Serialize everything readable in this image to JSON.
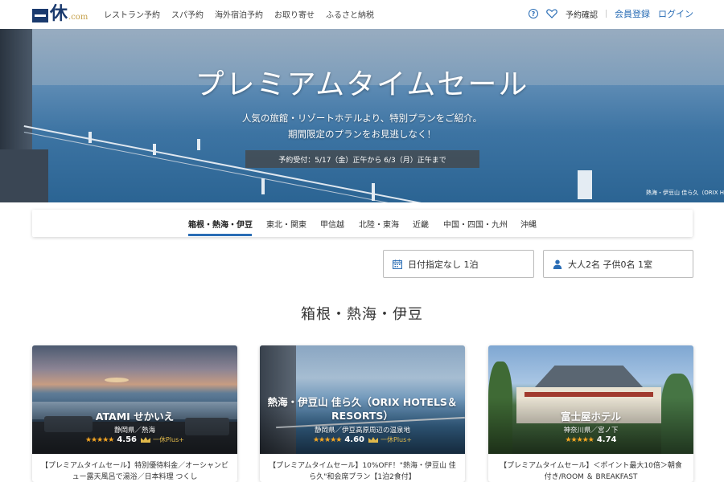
{
  "header": {
    "logo": {
      "kanji": "休",
      "suffix": ".com"
    },
    "nav": [
      "レストラン予約",
      "スパ予約",
      "海外宿泊予約",
      "お取り寄せ",
      "ふるさと納税"
    ],
    "help_icon": "help-circle-icon",
    "favorite_icon": "heart-icon",
    "booking_confirm": "予約確認",
    "register": "会員登録",
    "login": "ログイン"
  },
  "hero": {
    "title": "プレミアムタイムセール",
    "subtitle_line1": "人気の旅館・リゾートホテルより、特別プランをご紹介。",
    "subtitle_line2": "期間限定のプランをお見逃しなく！",
    "period": "予約受付：5/17（金）正午から 6/3（月）正午まで",
    "photo_credit": "熱海・伊豆山 佳ら久（ORIX H"
  },
  "region_tabs": [
    {
      "label": "箱根・熱海・伊豆",
      "active": true
    },
    {
      "label": "東北・関東",
      "active": false
    },
    {
      "label": "甲信越",
      "active": false
    },
    {
      "label": "北陸・東海",
      "active": false
    },
    {
      "label": "近畿",
      "active": false
    },
    {
      "label": "中国・四国・九州",
      "active": false
    },
    {
      "label": "沖縄",
      "active": false
    }
  ],
  "search": {
    "date": {
      "icon": "calendar-icon",
      "value": "日付指定なし 1泊"
    },
    "guests": {
      "icon": "person-icon",
      "value": "大人2名 子供0名 1室"
    }
  },
  "section_title": "箱根・熱海・伊豆",
  "cards": [
    {
      "name": "ATAMI せかいえ",
      "location": "静岡県／熱海",
      "rating": "4.56",
      "stars": "★★★★★",
      "plus": "一休Plus+",
      "description": "【プレミアムタイムセール】特別優待料金／オーシャンビュー露天風呂で湯浴／日本料理 つくし"
    },
    {
      "name": "熱海・伊豆山 佳ら久（ORIX HOTELS＆RESORTS）",
      "location": "静岡県／伊豆高原周辺の温泉地",
      "rating": "4.60",
      "stars": "★★★★★",
      "plus": "一休Plus+",
      "description": "【プレミアムタイムセール】10%OFF！\"熱海・伊豆山 佳ら久\"和会席プラン【1泊2食付】"
    },
    {
      "name": "富士屋ホテル",
      "location": "神奈川県／宮ノ下",
      "rating": "4.74",
      "stars": "★★★★★",
      "plus": "",
      "description": "【プレミアムタイムセール】＜ポイント最大10倍＞朝食付き/ROOM ＆ BREAKFAST"
    }
  ],
  "colors": {
    "brand": "#1a3a6e",
    "link": "#2a6db5",
    "star": "#f5a623",
    "gold": "#c5a04a"
  }
}
